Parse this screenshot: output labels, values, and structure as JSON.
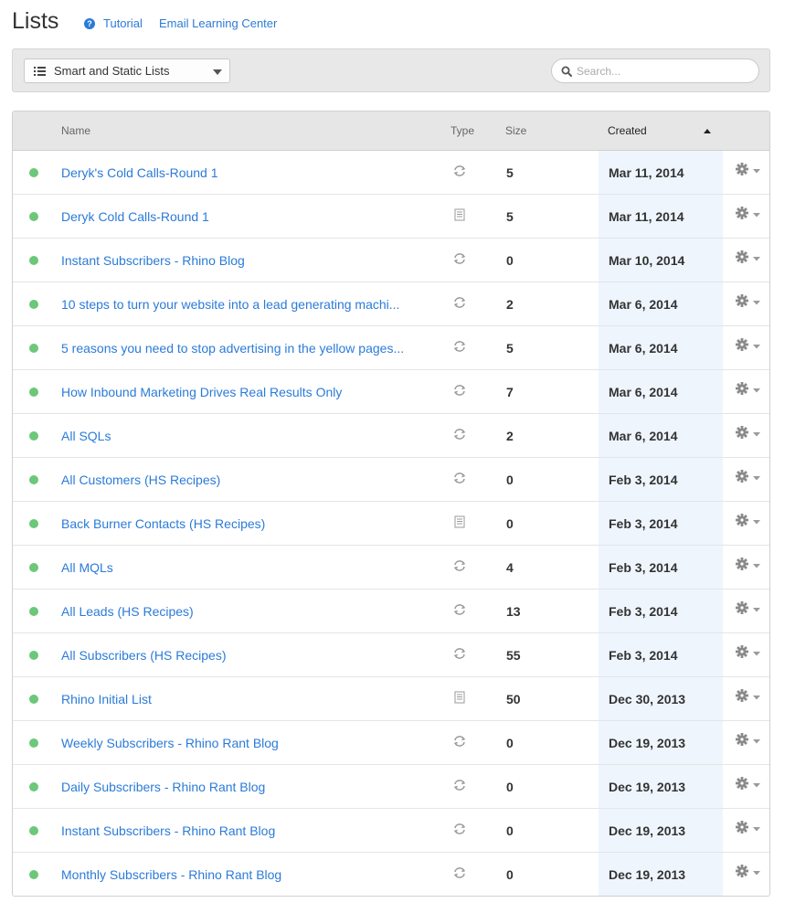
{
  "header": {
    "title": "Lists",
    "help_icon_glyph": "?",
    "tutorial_label": "Tutorial",
    "email_center_label": "Email Learning Center"
  },
  "toolbar": {
    "filter_label": "Smart and Static Lists",
    "search_placeholder": "Search..."
  },
  "table": {
    "columns": {
      "name": "Name",
      "type": "Type",
      "size": "Size",
      "created": "Created"
    },
    "sort": {
      "column": "created",
      "direction": "ascending"
    },
    "rows": [
      {
        "name": "Deryk's Cold Calls-Round 1",
        "type": "smart",
        "size": "5",
        "created": "Mar 11, 2014"
      },
      {
        "name": "Deryk Cold Calls-Round 1",
        "type": "static",
        "size": "5",
        "created": "Mar 11, 2014"
      },
      {
        "name": "Instant Subscribers - Rhino Blog",
        "type": "smart",
        "size": "0",
        "created": "Mar 10, 2014"
      },
      {
        "name": "10 steps to turn your website into a lead generating machi...",
        "type": "smart",
        "size": "2",
        "created": "Mar 6, 2014"
      },
      {
        "name": "5 reasons you need to stop advertising in the yellow pages...",
        "type": "smart",
        "size": "5",
        "created": "Mar 6, 2014"
      },
      {
        "name": "How Inbound Marketing Drives Real Results Only",
        "type": "smart",
        "size": "7",
        "created": "Mar 6, 2014"
      },
      {
        "name": "All SQLs",
        "type": "smart",
        "size": "2",
        "created": "Mar 6, 2014"
      },
      {
        "name": "All Customers (HS Recipes)",
        "type": "smart",
        "size": "0",
        "created": "Feb 3, 2014"
      },
      {
        "name": "Back Burner Contacts (HS Recipes)",
        "type": "static",
        "size": "0",
        "created": "Feb 3, 2014"
      },
      {
        "name": "All MQLs",
        "type": "smart",
        "size": "4",
        "created": "Feb 3, 2014"
      },
      {
        "name": "All Leads (HS Recipes)",
        "type": "smart",
        "size": "13",
        "created": "Feb 3, 2014"
      },
      {
        "name": "All Subscribers (HS Recipes)",
        "type": "smart",
        "size": "55",
        "created": "Feb 3, 2014"
      },
      {
        "name": "Rhino Initial List",
        "type": "static",
        "size": "50",
        "created": "Dec 30, 2013"
      },
      {
        "name": "Weekly Subscribers - Rhino Rant Blog",
        "type": "smart",
        "size": "0",
        "created": "Dec 19, 2013"
      },
      {
        "name": "Daily Subscribers - Rhino Rant Blog",
        "type": "smart",
        "size": "0",
        "created": "Dec 19, 2013"
      },
      {
        "name": "Instant Subscribers - Rhino Rant Blog",
        "type": "smart",
        "size": "0",
        "created": "Dec 19, 2013"
      },
      {
        "name": "Monthly Subscribers - Rhino Rant Blog",
        "type": "smart",
        "size": "0",
        "created": "Dec 19, 2013"
      }
    ]
  },
  "icons": {
    "status": "status-dot-icon",
    "smart": "refresh-icon",
    "static": "document-icon",
    "actions": "gear-icon",
    "filter": "list-icon",
    "search": "search-icon",
    "help": "help-icon"
  },
  "colors": {
    "link": "#2b7bd8",
    "status_active": "#6cc77a",
    "created_column_highlight": "#eef5fd",
    "toolbar_bg": "#e8e8e8",
    "header_bg": "#e6e6e6"
  }
}
